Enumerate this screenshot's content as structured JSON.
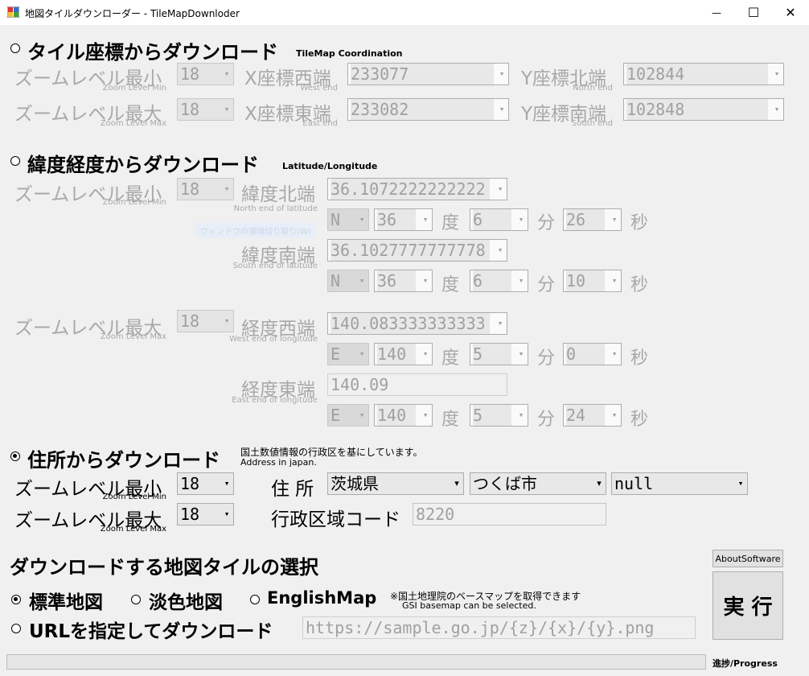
{
  "window": {
    "title": "地図タイルダウンローダー - TileMapDownloder",
    "minimize_glyph": "—",
    "maximize_glyph": "☐",
    "close_glyph": "✕"
  },
  "tile_section": {
    "title": "タイル座標からダウンロード",
    "subtitle": "TileMap Coordination",
    "zoom_min_label": "ズームレベル最小",
    "zoom_min_sub": "Zoom Level Min",
    "zoom_min_value": "18",
    "zoom_max_label": "ズームレベル最大",
    "zoom_max_sub": "Zoom Level Max",
    "zoom_max_value": "18",
    "x_west_label": "X座標西端",
    "x_west_sub": "West end",
    "x_west_value": "233077",
    "x_east_label": "X座標東端",
    "x_east_sub": "East end",
    "x_east_value": "233082",
    "y_north_label": "Y座標北端",
    "y_north_sub": "North end",
    "y_north_value": "102844",
    "y_south_label": "Y座標南端",
    "y_south_sub": "South end",
    "y_south_value": "102848"
  },
  "latlon_section": {
    "title": "緯度経度からダウンロード",
    "subtitle": "Latitude/Longitude",
    "zoom_min_label": "ズームレベル最小",
    "zoom_min_sub": "Zoom Level Min",
    "zoom_min_value": "18",
    "zoom_max_label": "ズームレベル最大",
    "zoom_max_sub": "Zoom Level Max",
    "zoom_max_value": "18",
    "lat_north_label": "緯度北端",
    "lat_north_sub": "North end of latitude",
    "lat_north_value": "36.1072222222222",
    "lat_north_hemi": "N",
    "lat_north_deg": "36",
    "lat_north_min": "6",
    "lat_north_sec": "26",
    "lat_south_label": "緯度南端",
    "lat_south_sub": "South end of latitude",
    "lat_south_value": "36.1027777777778",
    "lat_south_hemi": "N",
    "lat_south_deg": "36",
    "lat_south_min": "6",
    "lat_south_sec": "10",
    "lon_west_label": "経度西端",
    "lon_west_sub": "West end of longitude",
    "lon_west_value": "140.083333333333",
    "lon_west_hemi": "E",
    "lon_west_deg": "140",
    "lon_west_min": "5",
    "lon_west_sec": "0",
    "lon_east_label": "経度東端",
    "lon_east_sub": "East end of longitude",
    "lon_east_value": "140.09",
    "lon_east_hemi": "E",
    "lon_east_deg": "140",
    "lon_east_min": "5",
    "lon_east_sec": "24",
    "unit_deg": "度",
    "unit_min": "分",
    "unit_sec": "秒",
    "ghost_text": "ウィンドウの領域切り取り(W)"
  },
  "address_section": {
    "title": "住所からダウンロード",
    "note_jp": "国土数値情報の行政区を基にしています。",
    "note_en": "Address in japan.",
    "zoom_min_label": "ズームレベル最小",
    "zoom_min_sub": "Zoom Level Min",
    "zoom_min_value": "18",
    "zoom_max_label": "ズームレベル最大",
    "zoom_max_sub": "Zoom Level Max",
    "zoom_max_value": "18",
    "address_label": "住 所",
    "prefecture": "茨城県",
    "city": "つくば市",
    "district": "null",
    "code_label": "行政区域コード",
    "code_value": "8220"
  },
  "map_select": {
    "title": "ダウンロードする地図タイルの選択",
    "standard": "標準地図",
    "pale": "淡色地図",
    "english": "EnglishMap",
    "url_option": "URLを指定してダウンロード",
    "note_jp": "※国土地理院のベースマップを取得できます",
    "note_en": "GSI basemap can be selected.",
    "url_placeholder": "https://sample.go.jp/{z}/{x}/{y}.png"
  },
  "buttons": {
    "about": "AboutSoftware",
    "run": "実 行"
  },
  "progress": {
    "label": "進捗/Progress",
    "value": 0
  },
  "colors": {
    "client_bg": "#f0f0f0",
    "disabled_text": "#a8a8a8",
    "control_bg": "#e4e4e4"
  }
}
